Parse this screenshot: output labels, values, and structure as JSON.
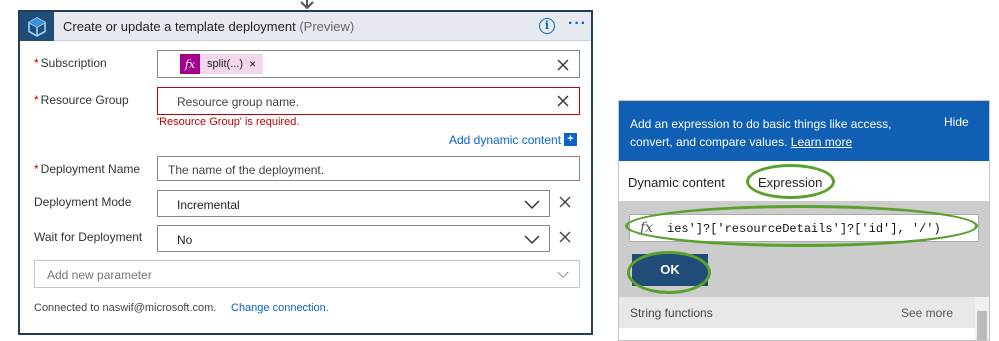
{
  "card": {
    "title": "Create or update a template deployment",
    "title_suffix": "(Preview)",
    "fields": {
      "subscription": {
        "label": "Subscription",
        "required_mark": "*",
        "token_label": "split(...)",
        "token_close": "×"
      },
      "resource_group": {
        "label": "Resource Group",
        "required_mark": "*",
        "placeholder": "Resource group name.",
        "error": "'Resource Group' is required."
      },
      "deployment_name": {
        "label": "Deployment Name",
        "required_mark": "*",
        "placeholder": "The name of the deployment."
      },
      "deployment_mode": {
        "label": "Deployment Mode",
        "value": "Incremental"
      },
      "wait_for_deployment": {
        "label": "Wait for Deployment",
        "value": "No"
      }
    },
    "add_dynamic_content": "Add dynamic content",
    "add_dynamic_plus": "+",
    "add_parameter_placeholder": "Add new parameter",
    "connected_text": "Connected to naswif@microsoft.com.",
    "change_connection": "Change connection."
  },
  "panel": {
    "description": "Add an expression to do basic things like access, convert, and compare values.",
    "learn_more": "Learn more",
    "hide": "Hide",
    "tabs": [
      "Dynamic content",
      "Expression"
    ],
    "expression_fx": "fx",
    "expression_value": "ies']?['resourceDetails']?['id'], '/')",
    "ok_label": "OK",
    "section_title": "String functions",
    "see_more": "See more"
  },
  "colors": {
    "card_border": "#233e5c",
    "link_blue": "#0a64c8",
    "error_red": "#c00000",
    "panel_header": "#0f5fb5",
    "highlight_green": "#5aa02c",
    "token_fx": "#a3008c"
  },
  "icons": [
    "connector-arrow-icon",
    "template-cube-icon",
    "info-icon",
    "more-options-icon",
    "fx-icon",
    "clear-icon",
    "chevron-down-icon",
    "plus-icon"
  ]
}
